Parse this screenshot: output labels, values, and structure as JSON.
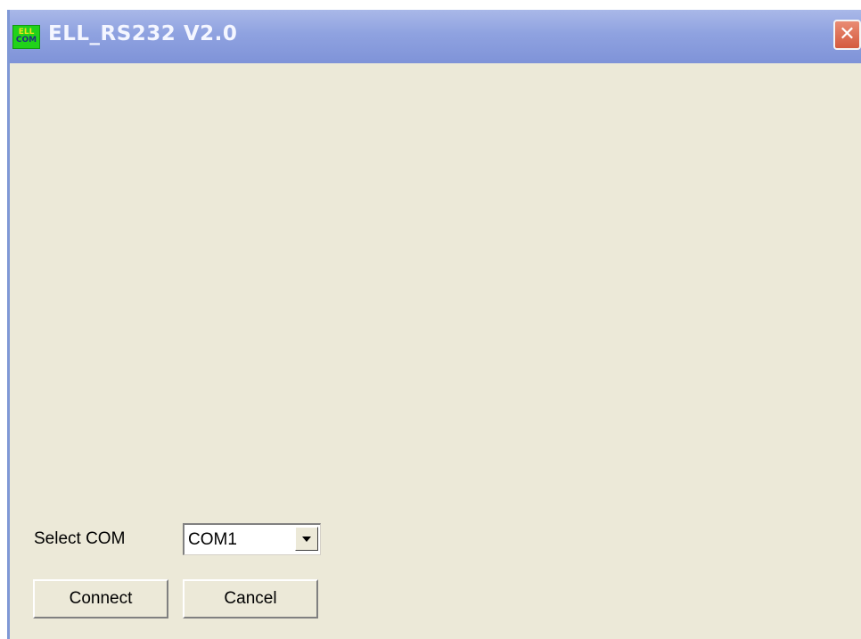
{
  "window": {
    "title": "ELL_RS232 V2.0",
    "icon": {
      "name": "ell-com-app-icon",
      "line1": "ELL",
      "line2": "COM"
    },
    "close_glyph": "✕"
  },
  "form": {
    "select_com_label": "Select COM",
    "com_combo": {
      "selected_value": "COM1"
    },
    "buttons": {
      "connect_label": "Connect",
      "cancel_label": "Cancel"
    }
  },
  "colors": {
    "titlebar": "#8FA2E0",
    "window_background": "#ECE9D8",
    "close_button": "#D45A3E",
    "app_icon": "#21D21A"
  }
}
